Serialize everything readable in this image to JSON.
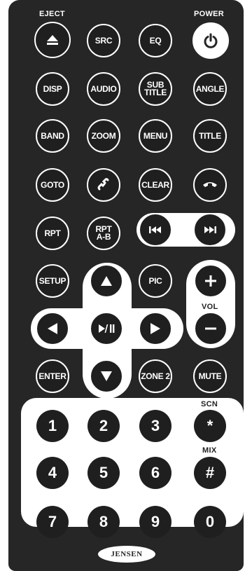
{
  "labels": {
    "eject": "EJECT",
    "power": "POWER",
    "vol": "VOL",
    "scn": "SCN",
    "mix": "MIX"
  },
  "buttons": {
    "src": "SRC",
    "eq": "EQ",
    "disp": "DISP",
    "audio": "AUDIO",
    "subtitle": "SUB\nTITLE",
    "angle": "ANGLE",
    "band": "BAND",
    "zoom": "ZOOM",
    "menu": "MENU",
    "title": "TITLE",
    "goto": "GOTO",
    "clear": "CLEAR",
    "rpt": "RPT",
    "rpt_ab": "RPT\nA-B",
    "setup": "SETUP",
    "pic": "PIC",
    "enter": "ENTER",
    "zone2": "ZONE 2",
    "mute": "MUTE"
  },
  "numpad": [
    "1",
    "2",
    "3",
    "*",
    "4",
    "5",
    "6",
    "#",
    "7",
    "8",
    "9",
    "0"
  ],
  "brand": "JENSEN",
  "icons": {
    "eject": "eject-icon",
    "power": "power-icon",
    "call": "phone-answer-icon",
    "hangup": "phone-hangup-icon",
    "prev": "skip-previous-icon",
    "next": "skip-next-icon",
    "up": "arrow-up-icon",
    "down": "arrow-down-icon",
    "left": "arrow-left-icon",
    "right": "arrow-right-icon",
    "play_pause": "play-pause-icon",
    "vol_up": "plus-icon",
    "vol_down": "minus-icon"
  },
  "colors": {
    "body": "#262626",
    "button": "#1f1f1f",
    "accent": "#ffffff"
  }
}
